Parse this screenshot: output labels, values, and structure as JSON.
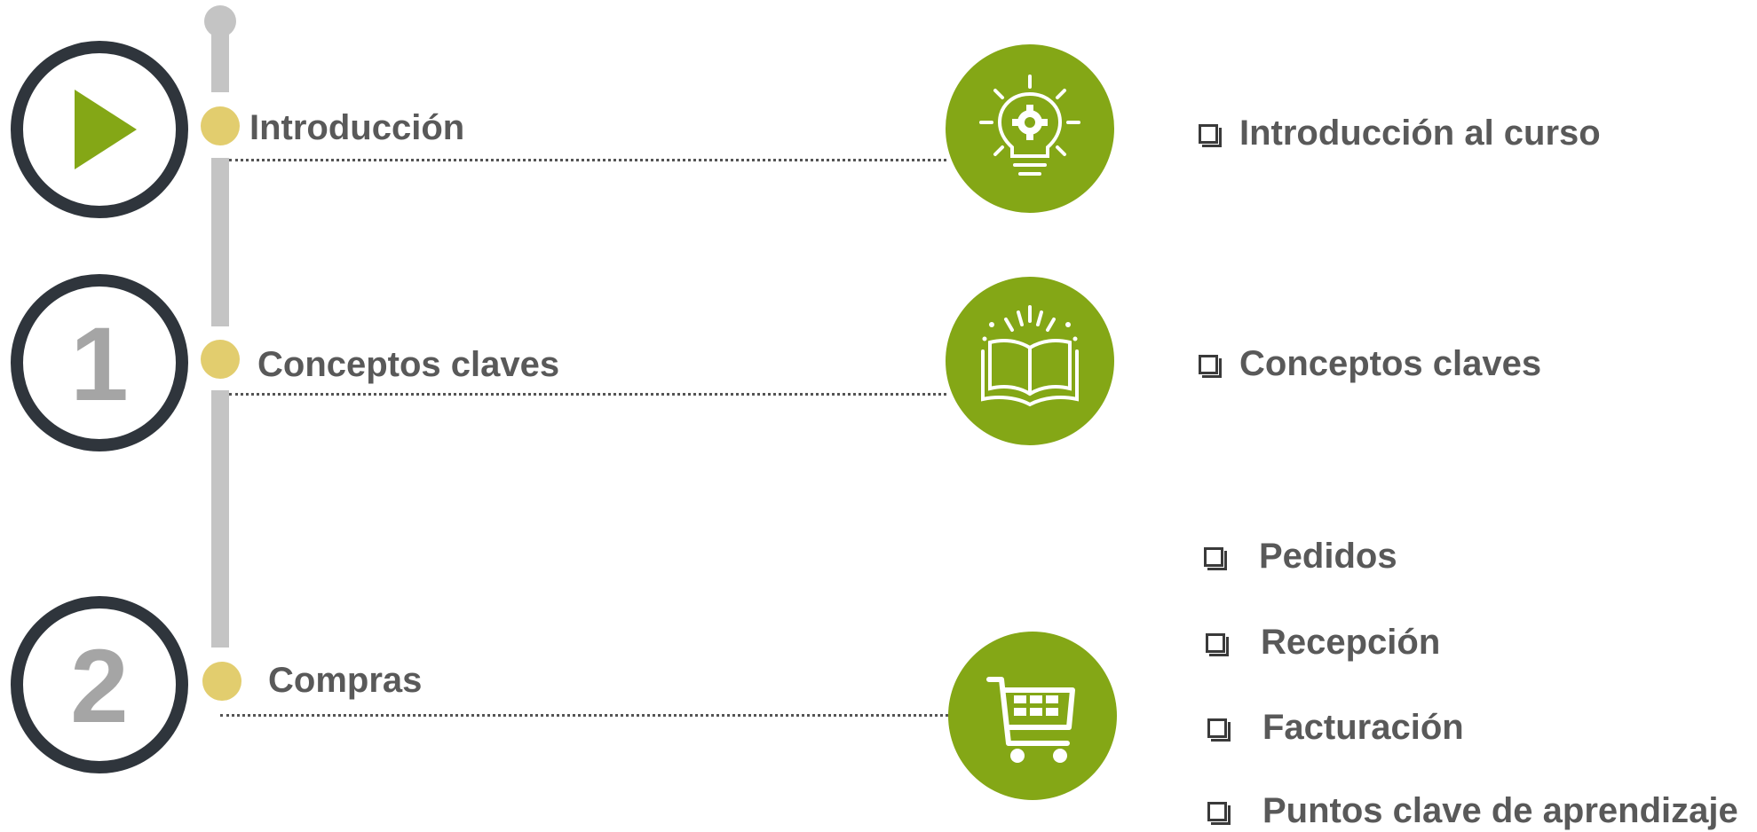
{
  "timeline": {
    "steps": [
      {
        "marker": "play-icon",
        "label": "Introducción",
        "icon": "lightbulb-gear-icon"
      },
      {
        "marker": "1",
        "label": "Conceptos claves",
        "icon": "open-book-icon"
      },
      {
        "marker": "2",
        "label": "Compras",
        "icon": "shopping-cart-icon"
      }
    ]
  },
  "topics": {
    "intro": [
      "Introducción al curso"
    ],
    "concepts": [
      "Conceptos claves"
    ],
    "purchases": [
      "Pedidos",
      "Recepción",
      "Facturación",
      "Puntos clave de aprendizaje"
    ]
  },
  "colors": {
    "accent_green": "#84a716",
    "ring_dark": "#2f353c",
    "timeline_gray": "#c4c4c4",
    "dot_yellow": "#e2cd6e",
    "text_gray": "#595959"
  }
}
